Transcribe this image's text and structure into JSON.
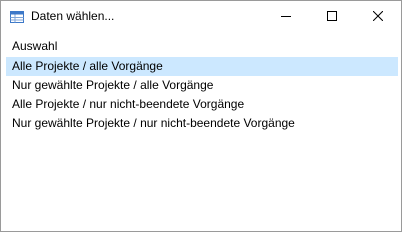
{
  "window": {
    "title": "Daten wählen...",
    "app_icon": "table-icon",
    "controls": [
      "minimize-icon",
      "maximize-icon",
      "close-icon"
    ]
  },
  "content": {
    "section_label": "Auswahl",
    "options": [
      {
        "label": "Alle Projekte / alle Vorgänge",
        "selected": true
      },
      {
        "label": "Nur gewählte Projekte / alle Vorgänge",
        "selected": false
      },
      {
        "label": "Alle Projekte / nur nicht-beendete Vorgänge",
        "selected": false
      },
      {
        "label": "Nur gewählte Projekte / nur nicht-beendete Vorgänge",
        "selected": false
      }
    ]
  },
  "colors": {
    "selection_background": "#cce8ff",
    "window_border": "#9a9a9a",
    "app_icon_accent": "#3c78c8"
  }
}
